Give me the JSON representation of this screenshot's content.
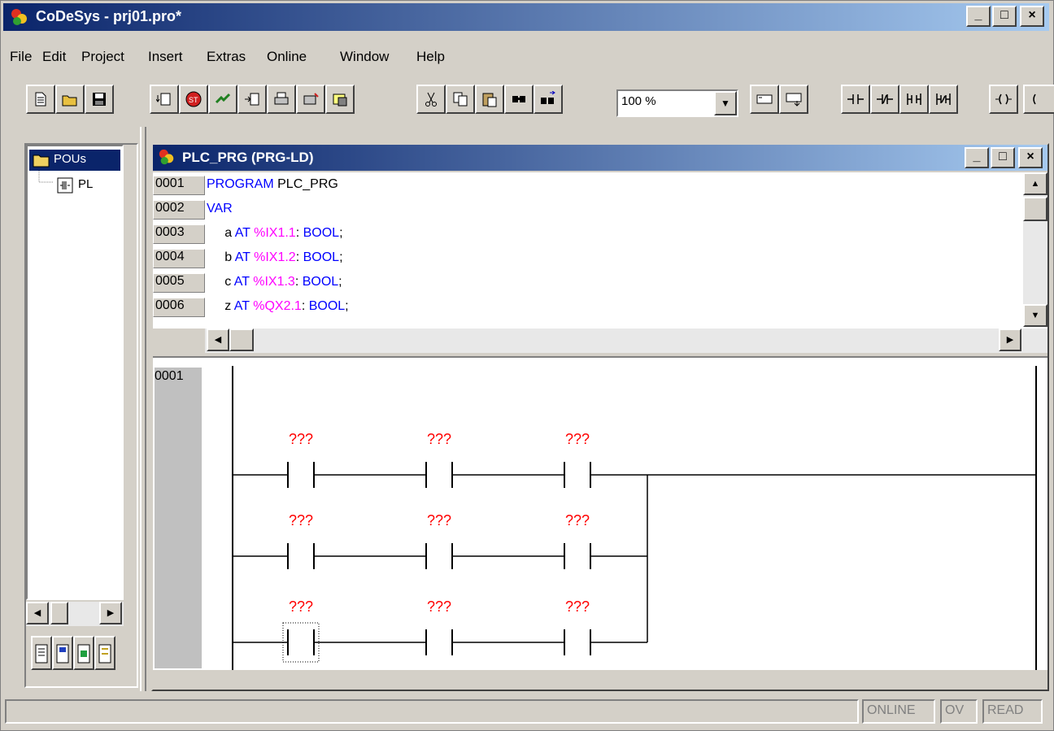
{
  "window": {
    "title": "CoDeSys - prj01.pro*",
    "controls": {
      "minimize": "_",
      "maximize": "□",
      "close": "×"
    }
  },
  "menu": {
    "items": [
      "File",
      "Edit",
      "Project",
      "Insert",
      "Extras",
      "Online",
      "Window",
      "Help"
    ]
  },
  "toolbar": {
    "zoom_value": "100 %",
    "buttons": [
      "new-icon",
      "open-icon",
      "save-icon",
      "build-icon",
      "stop-icon",
      "run-icon",
      "step-icon",
      "print-icon",
      "login-icon",
      "logout-icon",
      "cut-icon",
      "copy-icon",
      "paste-icon",
      "find-icon",
      "find-next-icon",
      "network-before-icon",
      "network-after-icon",
      "contact-icon",
      "negated-contact-icon",
      "parallel-contact-icon",
      "parallel-negated-contact-icon",
      "coil-icon"
    ]
  },
  "organizer": {
    "root_label": "POUs",
    "child_label": "PL",
    "tabs": [
      "pous-tab-icon",
      "datatypes-tab-icon",
      "visualizations-tab-icon",
      "resources-tab-icon"
    ]
  },
  "editor": {
    "title": "PLC_PRG (PRG-LD)",
    "declaration_lines": [
      {
        "num": "0001",
        "parts": [
          [
            "kw",
            "PROGRAM "
          ],
          [
            "var",
            "PLC_PRG"
          ]
        ]
      },
      {
        "num": "0002",
        "parts": [
          [
            "kw",
            "VAR"
          ]
        ]
      },
      {
        "num": "0003",
        "parts": [
          [
            "var",
            "     a "
          ],
          [
            "kw",
            "AT "
          ],
          [
            "addr",
            "%IX1.1"
          ],
          [
            "var",
            ": "
          ],
          [
            "kw",
            "BOOL"
          ],
          [
            "var",
            ";"
          ]
        ]
      },
      {
        "num": "0004",
        "parts": [
          [
            "var",
            "     b "
          ],
          [
            "kw",
            "AT "
          ],
          [
            "addr",
            "%IX1.2"
          ],
          [
            "var",
            ": "
          ],
          [
            "kw",
            "BOOL"
          ],
          [
            "var",
            ";"
          ]
        ]
      },
      {
        "num": "0005",
        "parts": [
          [
            "var",
            "     c "
          ],
          [
            "kw",
            "AT "
          ],
          [
            "addr",
            "%IX1.3"
          ],
          [
            "var",
            ": "
          ],
          [
            "kw",
            "BOOL"
          ],
          [
            "var",
            ";"
          ]
        ]
      },
      {
        "num": "0006",
        "parts": [
          [
            "var",
            "     z "
          ],
          [
            "kw",
            "AT "
          ],
          [
            "addr",
            "%QX2.1"
          ],
          [
            "var",
            ": "
          ],
          [
            "kw",
            "BOOL"
          ],
          [
            "var",
            ";"
          ]
        ]
      }
    ],
    "network_number": "0001",
    "contact_placeholder": "???",
    "contact_rows": 3,
    "contacts_per_row": 3
  },
  "statusbar": {
    "online": "ONLINE",
    "ov": "OV",
    "read": "READ"
  },
  "colors": {
    "title_active": "#0a246a",
    "keyword": "#0000ff",
    "address": "#ff00ff",
    "placeholder": "#ff0000"
  }
}
